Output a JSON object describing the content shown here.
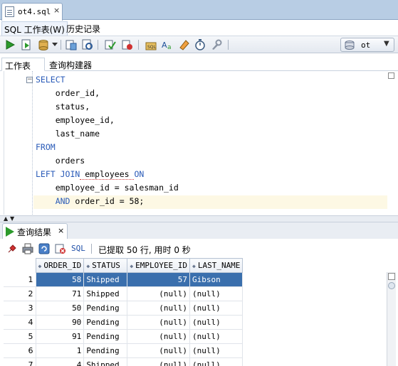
{
  "file_tab": {
    "label": "ot4.sql",
    "close": "×"
  },
  "subtabs": {
    "sql_worksheet": "SQL 工作表(W)",
    "history": "历史记录"
  },
  "connection": {
    "label": "ot"
  },
  "editor_tabs": {
    "worksheet": "工作表",
    "query_builder": "查询构建器"
  },
  "sql_lines": [
    {
      "kw": "SELECT",
      "rest": ""
    },
    {
      "kw": "",
      "rest": "    order_id,"
    },
    {
      "kw": "",
      "rest": "    status,"
    },
    {
      "kw": "",
      "rest": "    employee_id,"
    },
    {
      "kw": "",
      "rest": "    last_name"
    },
    {
      "kw": "FROM",
      "rest": ""
    },
    {
      "kw": "",
      "rest": "    orders"
    },
    {
      "kw": "LEFT JOIN",
      "rest": " employees ",
      "kw2": "ON"
    },
    {
      "kw": "",
      "rest": "    employee_id = salesman_id"
    },
    {
      "kw": "    AND",
      "rest": " order_id = 58;"
    }
  ],
  "results_tab": {
    "label": "查询结果",
    "close": "×"
  },
  "results_toolbar": {
    "sql_label": "SQL",
    "status": "已提取 50 行, 用时 0 秒"
  },
  "grid": {
    "columns": [
      "ORDER_ID",
      "STATUS",
      "EMPLOYEE_ID",
      "LAST_NAME"
    ],
    "rows": [
      {
        "n": "1",
        "order_id": "58",
        "status": "Shipped",
        "employee_id": "57",
        "last_name": "Gibson"
      },
      {
        "n": "2",
        "order_id": "71",
        "status": "Shipped",
        "employee_id": "(null)",
        "last_name": "(null)"
      },
      {
        "n": "3",
        "order_id": "50",
        "status": "Pending",
        "employee_id": "(null)",
        "last_name": "(null)"
      },
      {
        "n": "4",
        "order_id": "90",
        "status": "Pending",
        "employee_id": "(null)",
        "last_name": "(null)"
      },
      {
        "n": "5",
        "order_id": "91",
        "status": "Pending",
        "employee_id": "(null)",
        "last_name": "(null)"
      },
      {
        "n": "6",
        "order_id": "1",
        "status": "Pending",
        "employee_id": "(null)",
        "last_name": "(null)"
      },
      {
        "n": "7",
        "order_id": "4",
        "status": "Shipped",
        "employee_id": "(null)",
        "last_name": "(null)"
      }
    ]
  }
}
